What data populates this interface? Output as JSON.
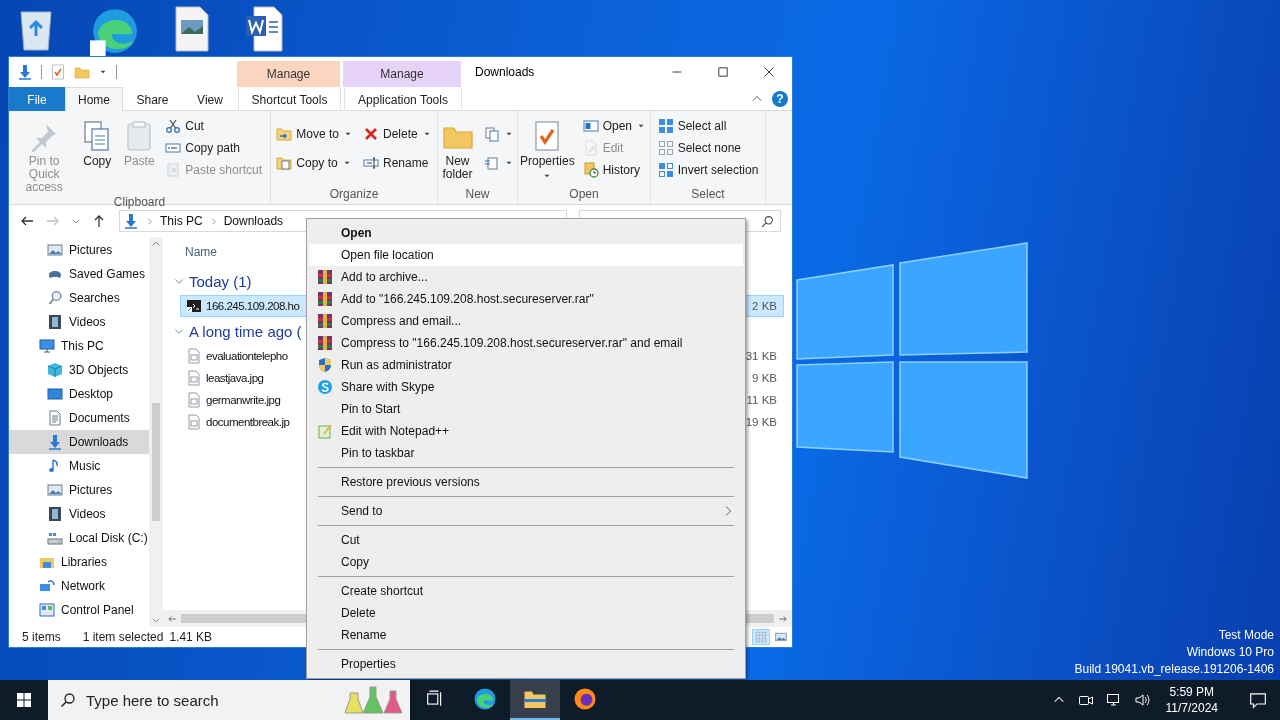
{
  "window": {
    "title": "Downloads",
    "help": "?"
  },
  "context_tabs": [
    {
      "header": "Manage",
      "label": "Shortcut Tools",
      "color": "#fcd5c0",
      "selected": false
    },
    {
      "header": "Manage",
      "label": "Application Tools",
      "color": "#e8d3f8",
      "selected": false
    }
  ],
  "tabs": [
    {
      "label": "File",
      "kind": "file",
      "selected": false
    },
    {
      "label": "Home",
      "kind": "tab",
      "selected": true
    },
    {
      "label": "Share",
      "kind": "tab",
      "selected": false
    },
    {
      "label": "View",
      "kind": "tab",
      "selected": false
    }
  ],
  "ribbon": [
    {
      "name": "Clipboard",
      "columns": [
        [
          {
            "kind": "large",
            "label": "Pin to Quick access",
            "disabled": true,
            "dropdown": false
          }
        ],
        [
          {
            "kind": "large",
            "label": "Copy",
            "disabled": false,
            "dropdown": false
          }
        ],
        [
          {
            "kind": "large",
            "label": "Paste",
            "disabled": true,
            "dropdown": false
          }
        ],
        [
          {
            "kind": "small",
            "label": "Cut",
            "disabled": false,
            "dropdown": false
          },
          {
            "kind": "small",
            "label": "Copy path",
            "disabled": false,
            "dropdown": false
          },
          {
            "kind": "small",
            "label": "Paste shortcut",
            "disabled": true,
            "dropdown": false
          }
        ]
      ]
    },
    {
      "name": "Organize",
      "columns": [
        [
          {
            "kind": "small",
            "label": "Move to",
            "disabled": false,
            "dropdown": true
          },
          {
            "kind": "small",
            "label": "Copy to",
            "disabled": false,
            "dropdown": true
          }
        ],
        [
          {
            "kind": "small",
            "label": "Delete",
            "disabled": false,
            "dropdown": true
          },
          {
            "kind": "small",
            "label": "Rename",
            "disabled": false,
            "dropdown": false
          }
        ]
      ]
    },
    {
      "name": "New",
      "columns": [
        [
          {
            "kind": "large",
            "label": "New folder",
            "disabled": false,
            "dropdown": false
          }
        ],
        [
          {
            "kind": "icon",
            "disabled": false,
            "dropdown": true
          },
          {
            "kind": "icon",
            "disabled": false,
            "dropdown": true
          }
        ]
      ]
    },
    {
      "name": "Open",
      "columns": [
        [
          {
            "kind": "large",
            "label": "Properties",
            "disabled": false,
            "dropdown": true
          }
        ],
        [
          {
            "kind": "small",
            "label": "Open",
            "disabled": false,
            "dropdown": true
          },
          {
            "kind": "small",
            "label": "Edit",
            "disabled": true,
            "dropdown": false
          },
          {
            "kind": "small",
            "label": "History",
            "disabled": false,
            "dropdown": false
          }
        ]
      ]
    },
    {
      "name": "Select",
      "columns": [
        [
          {
            "kind": "small",
            "label": "Select all",
            "disabled": false,
            "dropdown": false
          },
          {
            "kind": "small",
            "label": "Select none",
            "disabled": false,
            "dropdown": false
          },
          {
            "kind": "small",
            "label": "Invert selection",
            "disabled": false,
            "dropdown": false
          }
        ]
      ]
    }
  ],
  "nav_buttons": [
    {
      "disabled": false
    },
    {
      "disabled": true
    },
    {
      "disabled": false
    },
    {
      "disabled": false
    }
  ],
  "address": {
    "crumbs": [
      "This PC",
      "Downloads"
    ]
  },
  "nav": {
    "scrolled_children": [
      {
        "label": "Pictures",
        "selected": false
      },
      {
        "label": "Saved Games",
        "selected": false
      },
      {
        "label": "Searches",
        "selected": false
      },
      {
        "label": "Videos",
        "selected": false
      }
    ],
    "items": [
      {
        "label": "This PC",
        "selected": false,
        "children": [
          {
            "label": "3D Objects",
            "selected": false
          },
          {
            "label": "Desktop",
            "selected": false
          },
          {
            "label": "Documents",
            "selected": false
          },
          {
            "label": "Downloads",
            "selected": true
          },
          {
            "label": "Music",
            "selected": false
          },
          {
            "label": "Pictures",
            "selected": false
          },
          {
            "label": "Videos",
            "selected": false
          },
          {
            "label": "Local Disk (C:)",
            "selected": false
          }
        ]
      },
      {
        "label": "Libraries",
        "selected": false
      },
      {
        "label": "Network",
        "selected": false
      },
      {
        "label": "Control Panel",
        "selected": false
      }
    ]
  },
  "files": {
    "column": "Name",
    "groups": [
      {
        "label": "Today (1)",
        "expanded": true,
        "files": [
          {
            "name": "166.245.109.208.ho",
            "size": "2 KB",
            "selected": true
          }
        ]
      },
      {
        "label": "A long time ago (",
        "expanded": true,
        "files": [
          {
            "name": "evaluationtelepho",
            "size": "31 KB",
            "selected": false
          },
          {
            "name": "leastjava.jpg",
            "size": "9 KB",
            "selected": false
          },
          {
            "name": "germanwrite.jpg",
            "size": "11 KB",
            "selected": false
          },
          {
            "name": "documentbreak.jp",
            "size": "19 KB",
            "selected": false
          }
        ]
      }
    ]
  },
  "status": {
    "count": "5 items",
    "selection": "1 item selected",
    "size": "1.41 KB",
    "views": [
      {
        "selected": true
      },
      {
        "selected": false
      }
    ]
  },
  "context_menu": [
    {
      "kind": "item",
      "label": "Open",
      "default": true,
      "selected": false,
      "submenu": false
    },
    {
      "kind": "item",
      "label": "Open file location",
      "default": false,
      "selected": true,
      "submenu": false
    },
    {
      "kind": "item",
      "label": "Add to archive...",
      "default": false,
      "selected": false,
      "submenu": false
    },
    {
      "kind": "item",
      "label": "Add to \"166.245.109.208.host.secureserver.rar\"",
      "default": false,
      "selected": false,
      "submenu": false
    },
    {
      "kind": "item",
      "label": "Compress and email...",
      "default": false,
      "selected": false,
      "submenu": false
    },
    {
      "kind": "item",
      "label": "Compress to \"166.245.109.208.host.secureserver.rar\" and email",
      "default": false,
      "selected": false,
      "submenu": false
    },
    {
      "kind": "item",
      "label": "Run as administrator",
      "default": false,
      "selected": false,
      "submenu": false
    },
    {
      "kind": "item",
      "label": "Share with Skype",
      "default": false,
      "selected": false,
      "submenu": false
    },
    {
      "kind": "item",
      "label": "Pin to Start",
      "default": false,
      "selected": false,
      "submenu": false
    },
    {
      "kind": "item",
      "label": "Edit with Notepad++",
      "default": false,
      "selected": false,
      "submenu": false
    },
    {
      "kind": "item",
      "label": "Pin to taskbar",
      "default": false,
      "selected": false,
      "submenu": false
    },
    {
      "kind": "separator"
    },
    {
      "kind": "item",
      "label": "Restore previous versions",
      "default": false,
      "selected": false,
      "submenu": false
    },
    {
      "kind": "separator"
    },
    {
      "kind": "item",
      "label": "Send to",
      "default": false,
      "selected": false,
      "submenu": true
    },
    {
      "kind": "separator"
    },
    {
      "kind": "item",
      "label": "Cut",
      "default": false,
      "selected": false,
      "submenu": false
    },
    {
      "kind": "item",
      "label": "Copy",
      "default": false,
      "selected": false,
      "submenu": false
    },
    {
      "kind": "separator"
    },
    {
      "kind": "item",
      "label": "Create shortcut",
      "default": false,
      "selected": false,
      "submenu": false
    },
    {
      "kind": "item",
      "label": "Delete",
      "default": false,
      "selected": false,
      "submenu": false
    },
    {
      "kind": "item",
      "label": "Rename",
      "default": false,
      "selected": false,
      "submenu": false
    },
    {
      "kind": "separator"
    },
    {
      "kind": "item",
      "label": "Properties",
      "default": false,
      "selected": false,
      "submenu": false
    }
  ],
  "taskbar": {
    "search_placeholder": "Type here to search",
    "apps": [
      {
        "selected": false
      },
      {
        "selected": false
      },
      {
        "selected": true
      },
      {
        "selected": false
      }
    ],
    "time": "5:59 PM",
    "date": "11/7/2024"
  },
  "desktop": {
    "notice_lines": [
      "Test Mode",
      "Windows 10 Pro",
      "Build 19041.vb_release.191206-1406"
    ]
  }
}
